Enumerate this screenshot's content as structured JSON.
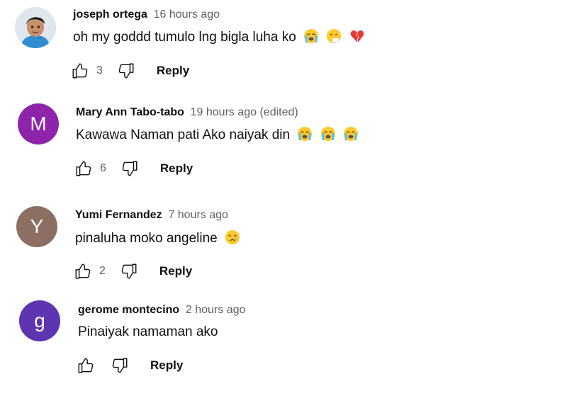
{
  "comments": [
    {
      "author": "joseph ortega",
      "time": "16 hours ago",
      "text": "oh my goddd tumulo lng bigla luha ko",
      "emojis": [
        "loudly-crying-face",
        "sneezing-face",
        "broken-heart"
      ],
      "likes": "3",
      "reply_label": "Reply",
      "avatar_type": "photo"
    },
    {
      "author": "Mary Ann Tabo-tabo",
      "time": "19 hours ago (edited)",
      "text": "Kawawa Naman pati Ako naiyak din",
      "emojis": [
        "loudly-crying-face",
        "loudly-crying-face",
        "loudly-crying-face"
      ],
      "likes": "6",
      "reply_label": "Reply",
      "avatar_letter": "M",
      "avatar_color": "#8e24aa"
    },
    {
      "author": "Yumi Fernandez",
      "time": "7 hours ago",
      "text": "pinaluha moko angeline",
      "emojis": [
        "crying-face"
      ],
      "likes": "2",
      "reply_label": "Reply",
      "avatar_letter": "Y",
      "avatar_color": "#8d6e63"
    },
    {
      "author": "gerome montecino",
      "time": "2 hours ago",
      "text": "Pinaiyak namaman ako",
      "emojis": [],
      "likes": "",
      "reply_label": "Reply",
      "avatar_letter": "g",
      "avatar_color": "#5e35b1"
    }
  ]
}
